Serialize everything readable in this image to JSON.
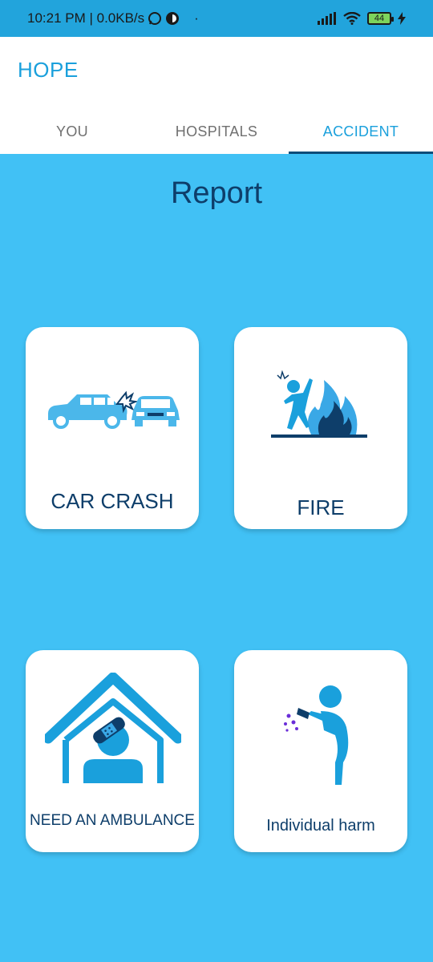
{
  "status_bar": {
    "time_speed": "10:21 PM | 0.0KB/s",
    "battery": "44"
  },
  "app": {
    "title": "HOPE"
  },
  "tabs": [
    {
      "label": "YOU",
      "active": false
    },
    {
      "label": "HOSPITALS",
      "active": false
    },
    {
      "label": "ACCIDENT",
      "active": true
    }
  ],
  "main": {
    "heading": "Report",
    "cards": [
      {
        "label": "CAR CRASH",
        "icon": "car-crash-icon"
      },
      {
        "label": "FIRE",
        "icon": "fire-icon"
      },
      {
        "label": "NEED AN AMBULANCE",
        "icon": "ambulance-home-icon"
      },
      {
        "label": "Individual harm",
        "icon": "individual-harm-icon"
      }
    ]
  },
  "colors": {
    "accent": "#1aa0dc",
    "background": "#41c1f5",
    "status_bar": "#22a4dc",
    "heading": "#0e3e6a"
  }
}
